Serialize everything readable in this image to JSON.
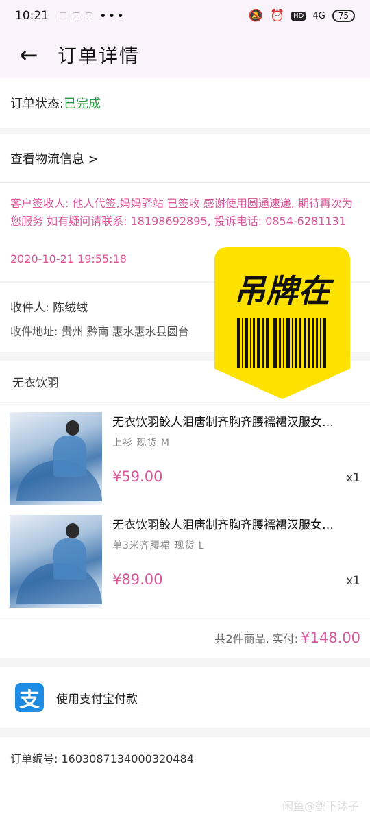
{
  "statusbar": {
    "time": "10:21",
    "more": "•••",
    "hd": "HD",
    "signal": "4G",
    "battery": "75"
  },
  "appbar": {
    "back": "←",
    "title": "订单详情"
  },
  "order_status": {
    "label": "订单状态: ",
    "value": "已完成"
  },
  "logistics": {
    "link": "查看物流信息 >",
    "message": "客户签收人: 他人代签,妈妈驿站 已签收 感谢使用圆通速递, 期待再次为您服务 如有疑问请联系: 18198692895, 投诉电话: 0854-6281131",
    "time": "2020-10-21 19:55:18"
  },
  "receiver": {
    "name": "收件人: 陈绒绒",
    "address": "收件地址: 贵州 黔南 惠水惠水县圆台"
  },
  "shop": {
    "name": "无衣饮羽"
  },
  "items": [
    {
      "name": "无衣饮羽鲛人泪唐制齐胸齐腰襦裙汉服女…",
      "spec": "上衫 现货  M",
      "price": "¥59.00",
      "qty": "x1"
    },
    {
      "name": "无衣饮羽鲛人泪唐制齐胸齐腰襦裙汉服女…",
      "spec": "单3米齐腰裙 现货  L",
      "price": "¥89.00",
      "qty": "x1"
    }
  ],
  "total": {
    "label": "共2件商品, 实付:",
    "value": "¥148.00"
  },
  "payment": {
    "icon": "支",
    "label": "使用支付宝付款"
  },
  "order_no": {
    "text": "订单编号: 1603087134000320484"
  },
  "watermark": "闲鱼@鹤下沐子",
  "tag": {
    "text": "吊牌在"
  },
  "colors": {
    "accent": "#d8579a",
    "status_green": "#2b9b3f",
    "alipay": "#1e8ce4",
    "tag_yellow": "#fde200"
  }
}
